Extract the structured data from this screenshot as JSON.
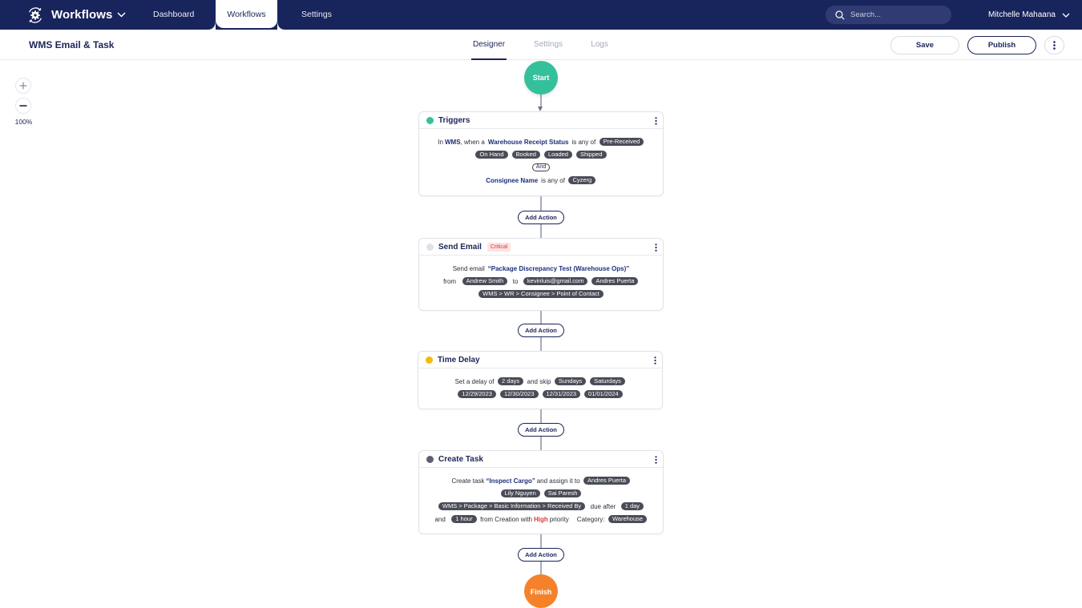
{
  "header": {
    "brand": "Workflows",
    "nav": [
      "Dashboard",
      "Workflows",
      "Settings"
    ],
    "active_nav": "Workflows",
    "search_placeholder": "Search...",
    "user_name": "Mitchelle Mahaana"
  },
  "subheader": {
    "title": "WMS Email & Task",
    "tabs": [
      "Designer",
      "Settings",
      "Logs"
    ],
    "active_tab": "Designer",
    "save_label": "Save",
    "publish_label": "Publish"
  },
  "zoom": {
    "level": "100%"
  },
  "flow": {
    "start_label": "Start",
    "finish_label": "Finish",
    "add_action_label": "Add Action",
    "triggers": {
      "title": "Triggers",
      "color": "#35c09c",
      "t1": "In",
      "system": "WMS",
      "t2": ", when a",
      "field": "Warehouse Receipt Status",
      "t3": "is any of",
      "statuses": [
        "Pre-Received",
        "On Hand",
        "Booked",
        "Loaded",
        "Shipped"
      ],
      "conjunction": "And",
      "field2": "Consignee Name",
      "t4": "is any of",
      "consignees": [
        "Cyzerg"
      ]
    },
    "send_email": {
      "title": "Send Email",
      "badge": "Critical",
      "color": "#dfe1ea",
      "t1": "Send email",
      "subject": "“Package Discrepancy Test (Warehouse Ops)”",
      "t_from": "from",
      "from": "Andrew Smith",
      "t_to": "to",
      "to": [
        "kevinluis@gmail.com",
        "Andres Puerta",
        "WMS > WR > Consignee > Point of Contact"
      ]
    },
    "time_delay": {
      "title": "Time Delay",
      "color": "#f5b90f",
      "t1": "Set a delay of",
      "delay": "2 days",
      "t2": "and skip",
      "skip": [
        "Sundays",
        "Saturdays",
        "12/29/2023",
        "12/30/2023",
        "12/31/2023",
        "01/01/2024"
      ]
    },
    "create_task": {
      "title": "Create Task",
      "color": "#5e5f6e",
      "t1": "Create task",
      "task": "“Inspect Cargo”",
      "t2": "and assign it to",
      "assignees": [
        "Andres Puerta",
        "Lily Nguyen",
        "Sai Paresh",
        "WMS > Package > Basic Information > Received By"
      ],
      "t3": "due after",
      "due": "1 day",
      "t4": "and",
      "due2": "1 hour",
      "t5": "from Creation with",
      "priority": "High",
      "t6": "priority",
      "t7": "Category:",
      "category": "Warehouse"
    }
  }
}
